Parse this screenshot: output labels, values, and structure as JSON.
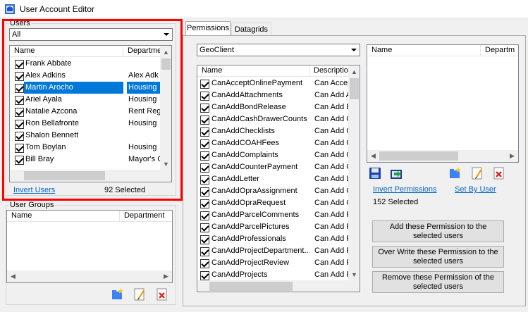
{
  "window": {
    "title": "User Account Editor"
  },
  "users": {
    "group_label": "Users",
    "filter_value": "All",
    "columns": [
      "Name",
      "Departme"
    ],
    "rows": [
      {
        "name": "Frank Abbate",
        "dept": ""
      },
      {
        "name": "Alex Adkins",
        "dept": "Alex Adk"
      },
      {
        "name": "Martin Arocho",
        "dept": "Housing",
        "selected": true
      },
      {
        "name": "Ariel Ayala",
        "dept": "Housing"
      },
      {
        "name": "Natalie Azcona",
        "dept": "Rent Reg"
      },
      {
        "name": "Ron Bellafronte",
        "dept": "Housing"
      },
      {
        "name": "Shalon Bennett",
        "dept": ""
      },
      {
        "name": "Tom Boylan",
        "dept": "Housing"
      },
      {
        "name": "Bill Bray",
        "dept": "Mayor's C"
      }
    ],
    "invert_label": "Invert Users",
    "selected_count": "92 Selected"
  },
  "user_groups": {
    "group_label": "User Groups",
    "columns": [
      "Name",
      "Department"
    ]
  },
  "tabs": [
    "Permissions",
    "Datagrids"
  ],
  "permissions": {
    "module_value": "GeoClient",
    "columns": [
      "Name",
      "Descriptio"
    ],
    "rows": [
      {
        "name": "CanAcceptOnlinePayment",
        "desc": "Can Accep"
      },
      {
        "name": "CanAddAttachments",
        "desc": "Can Add A"
      },
      {
        "name": "CanAddBondRelease",
        "desc": "Can Add B"
      },
      {
        "name": "CanAddCashDrawerCounts",
        "desc": "Can Add C"
      },
      {
        "name": "CanAddChecklists",
        "desc": "Can Add C"
      },
      {
        "name": "CanAddCOAHFees",
        "desc": "Can Add C"
      },
      {
        "name": "CanAddComplaints",
        "desc": "Can Add C"
      },
      {
        "name": "CanAddCounterPayment",
        "desc": "Can Add C"
      },
      {
        "name": "CanAddLetter",
        "desc": "Can Add L"
      },
      {
        "name": "CanAddOpraAssignment",
        "desc": "Can Add C"
      },
      {
        "name": "CanAddOpraRequest",
        "desc": "Can Add C"
      },
      {
        "name": "CanAddParcelComments",
        "desc": "Can Add F"
      },
      {
        "name": "CanAddParcelPictures",
        "desc": "Can Add F"
      },
      {
        "name": "CanAddProfessionals",
        "desc": "Can Add F"
      },
      {
        "name": "CanAddProjectDepartment...",
        "desc": "Can Add F"
      },
      {
        "name": "CanAddProjectReview",
        "desc": "Can Add F"
      },
      {
        "name": "CanAddProjects",
        "desc": "Can Add F"
      }
    ],
    "right_columns": [
      "Name",
      "Departm"
    ],
    "invert_label": "Invert Permissions",
    "set_by_user_label": "Set By User",
    "selected_count": "152 Selected",
    "add_button": "Add these Permission to the selected users",
    "overwrite_button": "Over Write these Permission to the selected users",
    "remove_button": "Remove these Permission of the selected users"
  }
}
